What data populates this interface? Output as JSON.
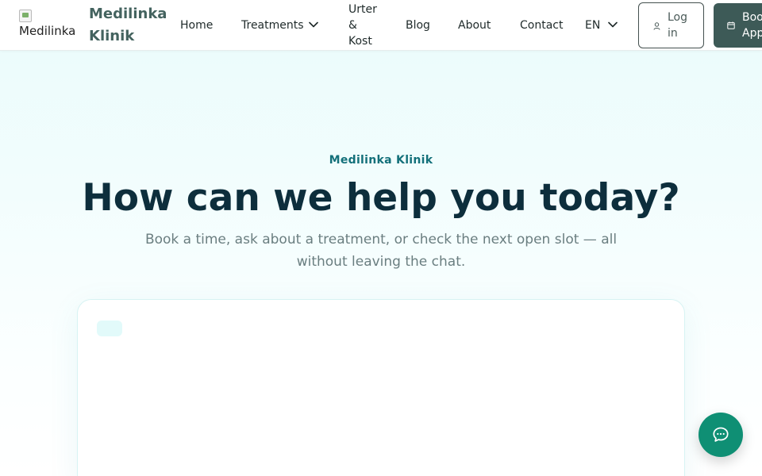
{
  "header": {
    "logo_alt": "Medilinka",
    "brand_name": "Medilinka Klinik",
    "nav": {
      "home": "Home",
      "treatments": "Treatments",
      "urter": "Urter & Kost",
      "blog": "Blog",
      "about": "About",
      "contact": "Contact",
      "language": "EN"
    },
    "login_label": "Log in",
    "book_label": "Book Appointment"
  },
  "hero": {
    "eyebrow": "Medilinka Klinik",
    "title": "How can we help you today?",
    "subtitle": "Book a time, ask about a treatment, or check the next open slot — all without leaving the chat."
  },
  "icons": {
    "treatments_dropdown": "chevron-down-icon",
    "language_dropdown": "chevron-down-icon",
    "login": "user-icon",
    "book": "calendar-icon",
    "fab": "chat-bubble-icon"
  },
  "colors": {
    "brand_text": "#44635f",
    "accent": "#13707a",
    "headline": "#0d2e3c",
    "book_button": "#3d5a57",
    "fab": "#0f8f74"
  }
}
